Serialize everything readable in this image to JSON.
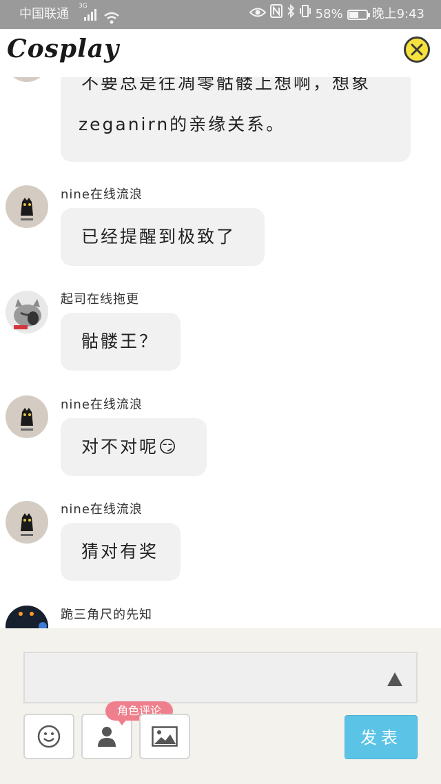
{
  "status_bar": {
    "carrier": "中国联通",
    "network": "3G",
    "battery": "58%",
    "battery_level": 0.58,
    "time": "晚上9:43",
    "icons": [
      "eye-icon",
      "nfc-icon",
      "bluetooth-icon",
      "vibrate-icon",
      "wifi-icon",
      "signal-icon"
    ]
  },
  "header": {
    "title": "Cosplay",
    "close_icon": "close-icon"
  },
  "messages": [
    {
      "user": "",
      "avatar": "nine-avatar",
      "lines": [
        "不要总是往凋零骷髅上想啊，想象",
        "zeganirn的亲缘关系。"
      ]
    },
    {
      "user": "nine在线流浪",
      "avatar": "nine-avatar",
      "lines": [
        "已经提醒到极致了"
      ]
    },
    {
      "user": "起司在线拖更",
      "avatar": "cat-avatar",
      "lines": [
        "骷髅王？"
      ]
    },
    {
      "user": "nine在线流浪",
      "avatar": "nine-avatar",
      "lines": [
        "对不对呢😏"
      ]
    },
    {
      "user": "nine在线流浪",
      "avatar": "nine-avatar",
      "lines": [
        "猜对有奖"
      ]
    },
    {
      "user": "跪三角尺的先知",
      "avatar": "dark-avatar",
      "lines": []
    }
  ],
  "composer": {
    "input_value": "",
    "emoji_icon": "smile-icon",
    "role_icon": "person-icon",
    "image_icon": "image-icon",
    "role_tip": "角色评论",
    "send_label": "发表"
  },
  "colors": {
    "status_bar": "#9a9a9a",
    "close_button": "#f7e23d",
    "bubble": "#f1f1f1",
    "composer_bg": "#f3f2ec",
    "role_tip": "#ef7f8c",
    "send_button": "#5bc4e6"
  }
}
